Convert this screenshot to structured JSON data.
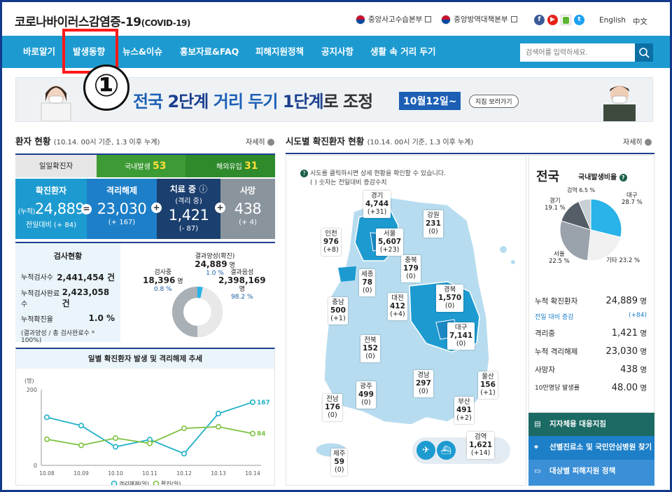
{
  "header": {
    "title": "코로나바이러스감염증-19",
    "title_sub": "(COVID-19)",
    "link1": "중앙사고수습본부",
    "link2": "중앙방역대책본부",
    "lang_en": "English",
    "lang_zh": "中文"
  },
  "nav": {
    "items": [
      "바로알기",
      "발생동향",
      "뉴스&이슈",
      "홍보자료&FAQ",
      "피해지원정책",
      "공지사항",
      "생활 속 거리 두기"
    ],
    "search_placeholder": "검색어를 입력하세요."
  },
  "annotation": {
    "marker": "①"
  },
  "banner": {
    "text_a": "전국 ",
    "text_b": "2단계 ",
    "text_c": "거리 두기 ",
    "text_d": "1단계",
    "text_e": "로 조정",
    "date": "10월12일~",
    "button": "지침 보러가기"
  },
  "patients": {
    "title": "환자 현황",
    "subtitle": "(10.14. 00시 기준, 1.3 이후 누계)",
    "more": "자세히",
    "daily_label": "일일확진자",
    "domestic_label": "국내발생",
    "domestic_value": "53",
    "overseas_label": "해외유입",
    "overseas_value": "31",
    "confirmed_title": "확진환자",
    "confirmed_prefix": "(누적)",
    "confirmed_value": "24,889",
    "confirmed_sub": "전일대비 (+ 84)",
    "released_title": "격리해제",
    "released_value": "23,030",
    "released_sub": "(+ 167)",
    "treat_title": "치료 중",
    "treat_sub_title": "(격리 중)",
    "treat_value": "1,421",
    "treat_sub": "(- 87)",
    "death_title": "사망",
    "death_value": "438",
    "death_sub": "(+ 4)"
  },
  "tests": {
    "title": "검사현황",
    "rows": [
      {
        "label": "누적검사수",
        "value": "2,441,454 건"
      },
      {
        "label": "누적검사완료수",
        "value": "2,423,058 건"
      },
      {
        "label": "누적확진율",
        "value": "1.0 %"
      }
    ],
    "note": "(결과양성 / 총 검사완료수 * 100%)",
    "pos_label": "결과양성(확진)",
    "pos_value": "24,889",
    "pos_unit": "명",
    "pos_pct": "1.0 %",
    "testing_label": "검사중",
    "testing_value": "18,396",
    "testing_unit": "명",
    "testing_pct": "0.8 %",
    "neg_label": "결과음성",
    "neg_value": "2,398,169",
    "neg_unit": "명",
    "neg_pct": "98.2 %"
  },
  "trend": {
    "title": "일별 확진환자 발생 및 격리해제 추세",
    "unit": "(명)",
    "yticks": [
      "200",
      "0"
    ],
    "legend_released": "격리해제(일)",
    "legend_confirmed": "확진(일)",
    "end_released": "167",
    "end_confirmed": "84"
  },
  "chart_data": {
    "type": "line",
    "categories": [
      "10.08",
      "10.09",
      "10.10",
      "10.11",
      "10.12",
      "10.13",
      "10.14"
    ],
    "ylim": [
      0,
      200
    ],
    "ylabel": "(명)",
    "series": [
      {
        "name": "격리해제(일)",
        "color": "#1fb0c8",
        "values": [
          127,
          105,
          49,
          68,
          31,
          137,
          167
        ]
      },
      {
        "name": "확진(일)",
        "color": "#7dc242",
        "values": [
          69,
          53,
          72,
          58,
          98,
          102,
          84
        ]
      }
    ]
  },
  "region": {
    "title": "시도별 확진환자 현황",
    "subtitle": "(10.14. 00시 기준, 1.3 이후 누계)",
    "more": "자세히",
    "hint1": "시도를 클릭하시면 상세 현황을 확인할 수 있습니다.",
    "hint2": "( ) 숫자는 전일대비 증감수치",
    "regions": [
      {
        "name": "경기",
        "value": "4,744",
        "diff": "(+31)"
      },
      {
        "name": "강원",
        "value": "231",
        "diff": "(0)"
      },
      {
        "name": "인천",
        "value": "976",
        "diff": "(+8)"
      },
      {
        "name": "서울",
        "value": "5,607",
        "diff": "(+23)"
      },
      {
        "name": "충북",
        "value": "179",
        "diff": "(0)"
      },
      {
        "name": "세종",
        "value": "78",
        "diff": "(0)"
      },
      {
        "name": "충남",
        "value": "500",
        "diff": "(+1)"
      },
      {
        "name": "대전",
        "value": "412",
        "diff": "(+4)"
      },
      {
        "name": "경북",
        "value": "1,570",
        "diff": "(0)"
      },
      {
        "name": "대구",
        "value": "7,141",
        "diff": "(0)"
      },
      {
        "name": "전북",
        "value": "152",
        "diff": "(0)"
      },
      {
        "name": "울산",
        "value": "156",
        "diff": "(+1)"
      },
      {
        "name": "경남",
        "value": "297",
        "diff": "(0)"
      },
      {
        "name": "광주",
        "value": "499",
        "diff": "(0)"
      },
      {
        "name": "전남",
        "value": "176",
        "diff": "(0)"
      },
      {
        "name": "부산",
        "value": "491",
        "diff": "(+2)"
      },
      {
        "name": "제주",
        "value": "59",
        "diff": "(0)"
      },
      {
        "name": "검역",
        "value": "1,621",
        "diff": "(+14)"
      }
    ]
  },
  "nation": {
    "title": "전국",
    "pie_title": "국내발생비율",
    "pie": [
      {
        "label": "대구",
        "pct": "28.7 %",
        "color": "#29b3e8"
      },
      {
        "label": "기타",
        "pct": "23.2 %",
        "color": "#f0f0f0"
      },
      {
        "label": "서울",
        "pct": "22.5 %",
        "color": "#9aa3ab"
      },
      {
        "label": "경기",
        "pct": "19.1 %",
        "color": "#555d66"
      },
      {
        "label": "검역",
        "pct": "6.5 %",
        "color": "#c8d0d6"
      }
    ],
    "stats": [
      {
        "label": "누적 확진환자",
        "value": "24,889",
        "unit": "명"
      },
      {
        "label": "격리중",
        "value": "1,421",
        "unit": "명"
      },
      {
        "label": "누적 격리해제",
        "value": "23,030",
        "unit": "명"
      },
      {
        "label": "사망자",
        "value": "438",
        "unit": "명"
      },
      {
        "label": "10만명당 발생률",
        "value": "48.00",
        "unit": "명"
      }
    ],
    "diff_label": "전일 대비 증감",
    "diff_value": "(+84)",
    "buttons": [
      "지자체용 대응지침",
      "선별진료소 및 국민안심병원 찾기",
      "대상별 피해지원 정책"
    ]
  }
}
